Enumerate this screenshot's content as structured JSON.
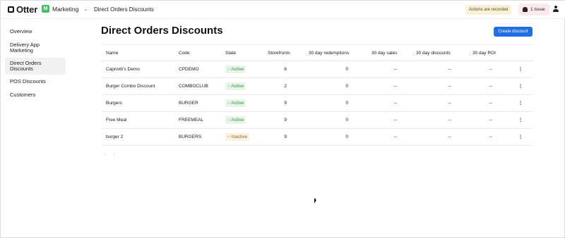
{
  "header": {
    "logo_text": "Otter",
    "app_icon": "M",
    "app_name": "Marketing",
    "breadcrumb": "Direct Orders Discounts",
    "recording_label": "Actions are recorded",
    "issue_label": "1 issue"
  },
  "sidebar": {
    "items": [
      {
        "label": "Overview"
      },
      {
        "label": "Delivery App Marketing"
      },
      {
        "label": "Direct Orders Discounts"
      },
      {
        "label": "POS Discounts"
      },
      {
        "label": "Customers"
      }
    ],
    "active_index": 2
  },
  "main": {
    "title": "Direct Orders Discounts",
    "create_button": "Create discount",
    "columns": [
      "Name",
      "Code",
      "State",
      "Storefronts",
      "30 day redemptions",
      "30 day sales",
      "30 day discounts",
      "30 day ROI"
    ],
    "rows": [
      {
        "name": "Capriotti's Demo",
        "code": "CPDEMO",
        "state": "Active",
        "storefronts": "6",
        "redemptions": "0",
        "sales": "--",
        "discounts": "--",
        "roi": "--",
        "menu": "⋮"
      },
      {
        "name": "Burger Combo Discount",
        "code": "COMBOCLUB",
        "state": "Active",
        "storefronts": "2",
        "redemptions": "0",
        "sales": "--",
        "discounts": "--",
        "roi": "--",
        "menu": "⋮"
      },
      {
        "name": "Burgers",
        "code": "BURGER",
        "state": "Active",
        "storefronts": "9",
        "redemptions": "0",
        "sales": "--",
        "discounts": "--",
        "roi": "--",
        "menu": "⋮"
      },
      {
        "name": "Free Meal",
        "code": "FREEMEAL",
        "state": "Active",
        "storefronts": "9",
        "redemptions": "0",
        "sales": "--",
        "discounts": "--",
        "roi": "--",
        "menu": "⋮"
      },
      {
        "name": "burger 2",
        "code": "BURGERS",
        "state": "Inactive",
        "storefronts": "9",
        "redemptions": "0",
        "sales": "--",
        "discounts": "--",
        "roi": "--",
        "menu": "⋮"
      }
    ],
    "pager": {
      "prev": "‹",
      "next": "›"
    }
  },
  "icons": {
    "logo": "otter-logo-icon",
    "app": "marketing-app-icon",
    "chevron": "chevron-down-icon",
    "bell": "bell-icon",
    "user": "user-icon",
    "row_menu": "kebab-menu-icon",
    "state_dot": "status-dot-icon"
  },
  "colors": {
    "accent": "#1f6fe5",
    "active_badge_bg": "#e8f6ea",
    "active_badge_text": "#2f8a3e",
    "inactive_badge_bg": "#fbf2e1",
    "inactive_badge_text": "#8a6a2a",
    "app_icon": "#3ec26a"
  }
}
